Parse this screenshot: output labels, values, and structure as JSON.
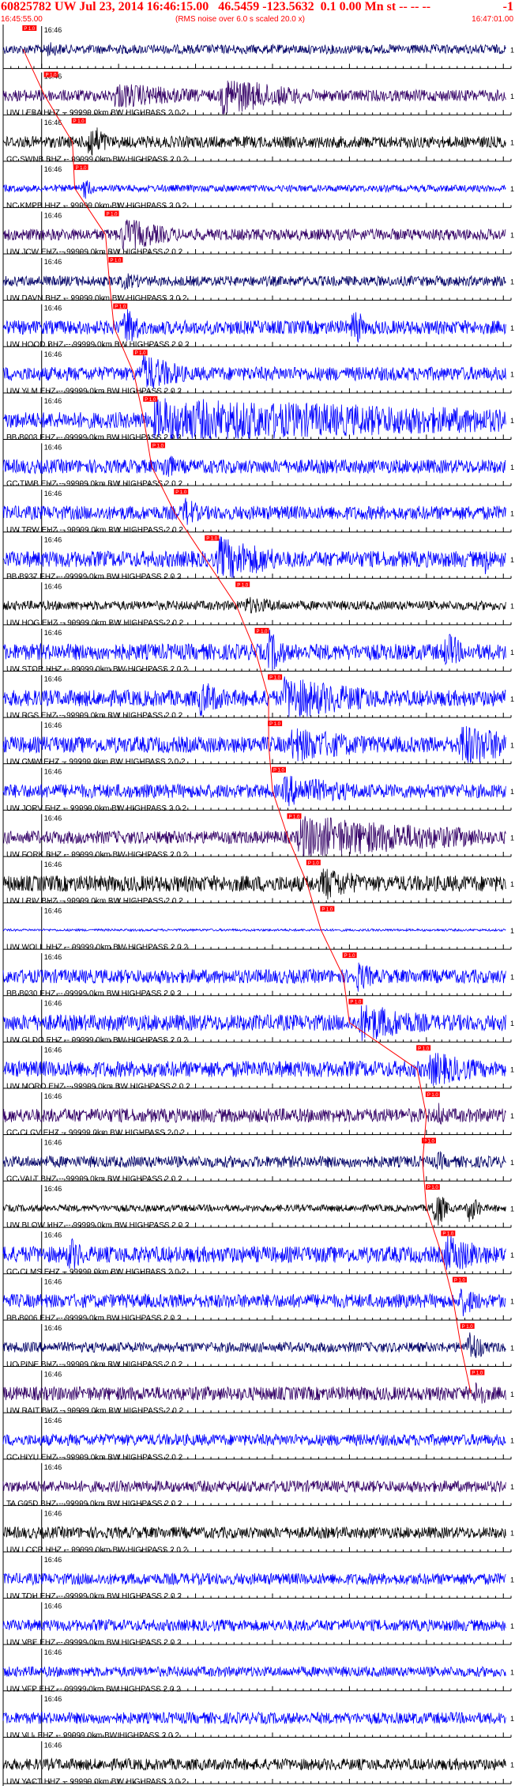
{
  "header": {
    "title": "60825782 UW Jul 23, 2014 16:46:15.00   46.5459 -123.5632  0.1 0.00 Mn st -- -- --",
    "title_end": "-1",
    "start_time": "16:45:55.00",
    "note": "(RMS noise over 6.0 s scaled 20.0 x)",
    "end_time": "16:47:01.00"
  },
  "chart_data": {
    "type": "line",
    "title": "60825782 UW Jul 23, 2014 16:46:15.00   46.5459 -123.5632  0.1 0.00 Mn st -- -- --",
    "x_start": "16:45:55.00",
    "x_end": "16:47:01.00",
    "x_range_seconds": [
      0,
      66
    ],
    "tick_interval_seconds": 1,
    "minute_label": "16:46",
    "minute_label_second": 5,
    "channel_suffix": " -- 99999.0km BW  HIGHPASS  2.0  2",
    "pick_label": "P 1.0",
    "colors": {
      "blue": "#0000ff",
      "navy": "#000066",
      "black": "#000000",
      "purple": "#330066",
      "pick": "#ff0000",
      "axis": "#000000"
    },
    "traces": [
      {
        "label": "",
        "color": "#000066",
        "noise": 0.2,
        "pick": 2.6,
        "bursts": [
          [
            5,
            60,
            0.35,
            3
          ]
        ]
      },
      {
        "label": "UW LEBA HHZ",
        "color": "#330066",
        "noise": 0.25,
        "pick": 5.4,
        "bursts": [
          [
            28,
            40,
            0.9,
            6
          ],
          [
            14,
            55,
            0.6,
            8
          ]
        ]
      },
      {
        "label": "CC SWNB BHZ",
        "color": "#000000",
        "noise": 0.25,
        "pick": 9.0,
        "bursts": [
          [
            10.5,
            13,
            0.9,
            2
          ]
        ]
      },
      {
        "label": "NC KMPB HHZ",
        "color": "#0000ff",
        "noise": 0.15,
        "pick": 9.3,
        "bursts": [
          [
            10,
            11.5,
            0.5,
            1
          ]
        ]
      },
      {
        "label": "UW JCW EHZ",
        "color": "#330066",
        "noise": 0.25,
        "pick": 13.3,
        "bursts": [
          [
            15,
            25,
            0.8,
            4
          ]
        ]
      },
      {
        "label": "UW DAVN BHZ",
        "color": "#000066",
        "noise": 0.22,
        "pick": 13.8,
        "bursts": [
          [
            15,
            20,
            0.4,
            3
          ]
        ]
      },
      {
        "label": "UW HOOD BHZ",
        "color": "#0000ff",
        "noise": 0.3,
        "pick": 14.4,
        "bursts": [
          [
            15.3,
            17.5,
            1.0,
            1.5
          ],
          [
            45,
            46.5,
            1.0,
            1
          ]
        ]
      },
      {
        "label": "UW YLM EHZ",
        "color": "#0000ff",
        "noise": 0.3,
        "pick": 17.0,
        "bursts": [
          [
            17.5,
            23,
            0.9,
            4
          ]
        ]
      },
      {
        "label": "PB B003 EHZ",
        "color": "#0000ff",
        "noise": 0.35,
        "pick": 18.3,
        "bursts": [
          [
            19,
            66,
            1.0,
            40
          ]
        ]
      },
      {
        "label": "CC TIMB EHZ",
        "color": "#0000ff",
        "noise": 0.3,
        "pick": 19.3,
        "bursts": [
          [
            20.5,
            22,
            0.8,
            1
          ]
        ]
      },
      {
        "label": "UW TRW EHZ",
        "color": "#0000ff",
        "noise": 0.3,
        "pick": 22.3,
        "bursts": [
          [
            23,
            25,
            0.7,
            2
          ]
        ]
      },
      {
        "label": "PB B937 EHZ",
        "color": "#0000ff",
        "noise": 0.35,
        "pick": 26.3,
        "bursts": [
          [
            27.5,
            35,
            1.0,
            6
          ],
          [
            62,
            64,
            0.7,
            1
          ]
        ]
      },
      {
        "label": "UW HOG EHZ",
        "color": "#000000",
        "noise": 0.2,
        "pick": 30.3,
        "bursts": [
          [
            31,
            38,
            0.4,
            5
          ]
        ]
      },
      {
        "label": "UW STOR HHZ",
        "color": "#0000ff",
        "noise": 0.35,
        "pick": 32.8,
        "bursts": [
          [
            34,
            36,
            1.0,
            2
          ],
          [
            57,
            59,
            0.9,
            2
          ]
        ]
      },
      {
        "label": "UW RGS EHZ",
        "color": "#0000ff",
        "noise": 0.35,
        "pick": 34.5,
        "bursts": [
          [
            36,
            50,
            1.0,
            8
          ],
          [
            25,
            29,
            0.8,
            3
          ]
        ]
      },
      {
        "label": "UW CMW EHZ",
        "color": "#0000ff",
        "noise": 0.35,
        "pick": 34.5,
        "bursts": [
          [
            37,
            48,
            0.8,
            8
          ],
          [
            59,
            66,
            1.0,
            6
          ]
        ]
      },
      {
        "label": "UW JORV EHZ",
        "color": "#0000ff",
        "noise": 0.3,
        "pick": 35.0,
        "bursts": [
          [
            36,
            48,
            0.7,
            8
          ]
        ]
      },
      {
        "label": "UW FORK BHZ",
        "color": "#330066",
        "noise": 0.28,
        "pick": 37.0,
        "bursts": [
          [
            38,
            60,
            1.0,
            15
          ]
        ]
      },
      {
        "label": "UW LRIV BHZ",
        "color": "#000000",
        "noise": 0.35,
        "pick": 39.5,
        "bursts": [
          [
            41,
            46,
            0.8,
            4
          ]
        ]
      },
      {
        "label": "UW WOLL HHZ",
        "color": "#0000ff",
        "noise": 0.05,
        "pick": 41.3,
        "bursts": []
      },
      {
        "label": "PB B030 EHZ",
        "color": "#0000ff",
        "noise": 0.3,
        "pick": 44.2,
        "bursts": [
          [
            45.5,
            48,
            0.7,
            2
          ]
        ]
      },
      {
        "label": "UW GLDO EHZ",
        "color": "#0000ff",
        "noise": 0.35,
        "pick": 45.0,
        "bursts": [
          [
            46,
            55,
            0.9,
            6
          ]
        ]
      },
      {
        "label": "UW MORO EHZ",
        "color": "#0000ff",
        "noise": 0.35,
        "pick": 53.8,
        "bursts": [
          [
            55,
            62,
            0.8,
            5
          ]
        ]
      },
      {
        "label": "CC CLCV EHZ",
        "color": "#330066",
        "noise": 0.3,
        "pick": 55.0,
        "bursts": [
          [
            56,
            58,
            0.6,
            1
          ]
        ]
      },
      {
        "label": "CC VALT BHZ",
        "color": "#000066",
        "noise": 0.25,
        "pick": 54.5,
        "bursts": [
          [
            56,
            57.5,
            0.5,
            1
          ]
        ]
      },
      {
        "label": "UW BLOW HHZ",
        "color": "#000000",
        "noise": 0.15,
        "pick": 55.0,
        "bursts": [
          [
            55.5,
            57,
            0.9,
            1.5
          ],
          [
            60,
            62,
            0.7,
            1
          ]
        ]
      },
      {
        "label": "CC CLMS EHZ",
        "color": "#0000ff",
        "noise": 0.35,
        "pick": 57.0,
        "bursts": [
          [
            8,
            10,
            0.8,
            2
          ],
          [
            57,
            63,
            0.9,
            4
          ]
        ]
      },
      {
        "label": "PB B006 EHZ",
        "color": "#0000ff",
        "noise": 0.3,
        "pick": 58.5,
        "bursts": [
          [
            59,
            62,
            0.7,
            2
          ]
        ]
      },
      {
        "label": "UO PINE BHZ",
        "color": "#000066",
        "noise": 0.22,
        "pick": 59.5,
        "bursts": [
          [
            60,
            62,
            0.8,
            1.5
          ]
        ]
      },
      {
        "label": "UW RAIT BHZ",
        "color": "#330066",
        "noise": 0.3,
        "pick": 60.8,
        "bursts": [
          [
            61,
            62.5,
            0.8,
            1
          ]
        ]
      },
      {
        "label": "CC HIYU EHZ",
        "color": "#0000ff",
        "noise": 0.25,
        "pick": null,
        "bursts": []
      },
      {
        "label": "TA G05D BHZ",
        "color": "#330066",
        "noise": 0.25,
        "pick": null,
        "bursts": []
      },
      {
        "label": "UW LCCR HHZ",
        "color": "#000000",
        "noise": 0.25,
        "pick": null,
        "bursts": []
      },
      {
        "label": "UW TDH EHZ",
        "color": "#0000ff",
        "noise": 0.25,
        "pick": null,
        "bursts": []
      },
      {
        "label": "UW VBE EHZ",
        "color": "#0000ff",
        "noise": 0.25,
        "pick": null,
        "bursts": []
      },
      {
        "label": "UW VFP EHZ",
        "color": "#0000ff",
        "noise": 0.22,
        "pick": null,
        "bursts": []
      },
      {
        "label": "UW VLL EHZ",
        "color": "#0000ff",
        "noise": 0.25,
        "pick": null,
        "bursts": []
      },
      {
        "label": "UW YACT HHZ",
        "color": "#000000",
        "noise": 0.25,
        "pick": null,
        "bursts": []
      }
    ]
  }
}
